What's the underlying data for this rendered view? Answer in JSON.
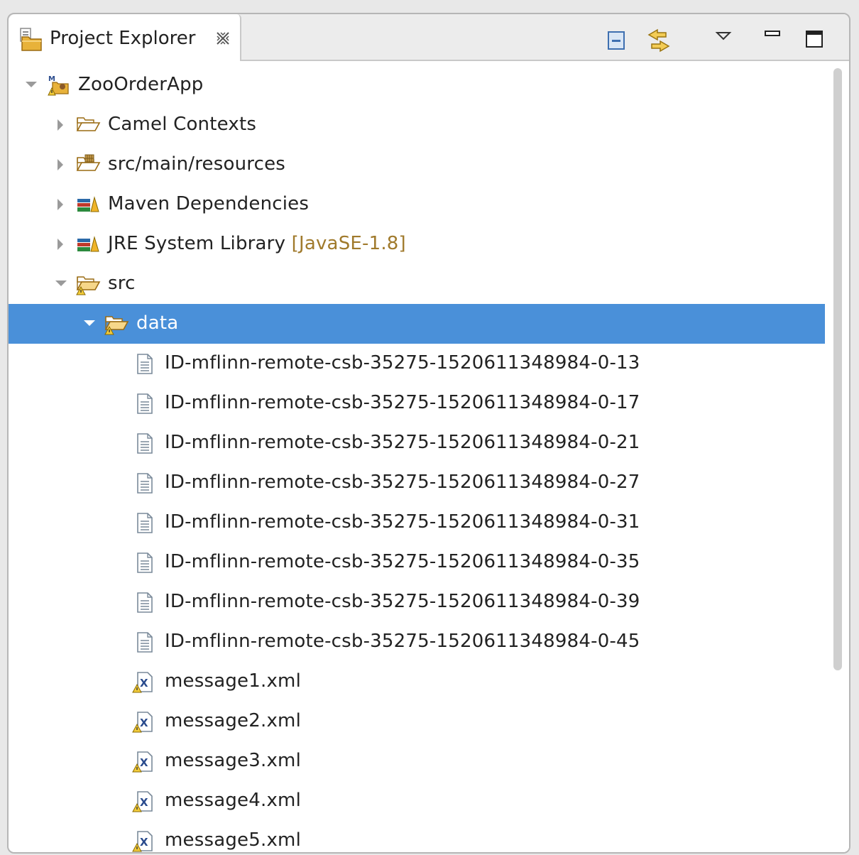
{
  "panel": {
    "title": "Project Explorer",
    "icons": [
      "project-explorer-icon",
      "close-icon",
      "collapse-all-icon",
      "link-with-editor-icon",
      "view-menu-icon",
      "minimize-icon",
      "maximize-icon"
    ]
  },
  "colors": {
    "selection": "#4a90d9",
    "decoration": "#a07a2c",
    "folder": "#e8b23a"
  },
  "tree": {
    "project": {
      "label": "ZooOrderApp"
    },
    "camel_contexts": {
      "label": "Camel Contexts"
    },
    "resources": {
      "label": "src/main/resources"
    },
    "maven": {
      "label": "Maven Dependencies"
    },
    "jre": {
      "label": "JRE System Library",
      "decoration": "[JavaSE-1.8]"
    },
    "src": {
      "label": "src"
    },
    "data": {
      "label": "data"
    },
    "files": [
      "ID-mflinn-remote-csb-35275-1520611348984-0-13",
      "ID-mflinn-remote-csb-35275-1520611348984-0-17",
      "ID-mflinn-remote-csb-35275-1520611348984-0-21",
      "ID-mflinn-remote-csb-35275-1520611348984-0-27",
      "ID-mflinn-remote-csb-35275-1520611348984-0-31",
      "ID-mflinn-remote-csb-35275-1520611348984-0-35",
      "ID-mflinn-remote-csb-35275-1520611348984-0-39",
      "ID-mflinn-remote-csb-35275-1520611348984-0-45"
    ],
    "xml_files": [
      "message1.xml",
      "message2.xml",
      "message3.xml",
      "message4.xml",
      "message5.xml"
    ]
  }
}
